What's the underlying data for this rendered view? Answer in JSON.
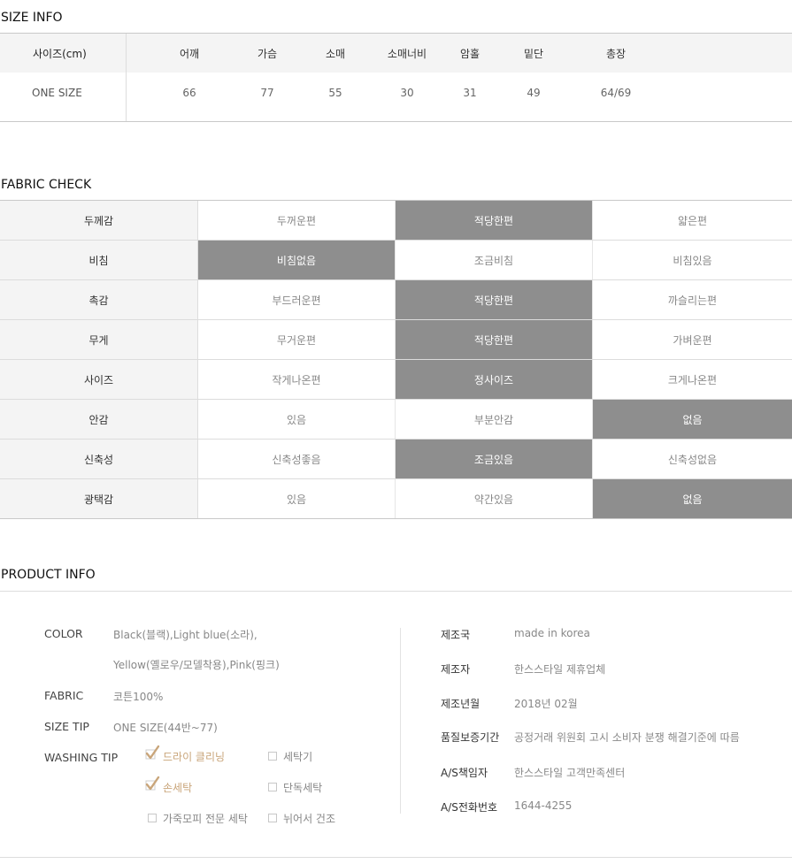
{
  "size_info": {
    "title": "SIZE INFO",
    "header_label": "사이즈(cm)",
    "columns": [
      "어깨",
      "가슴",
      "소매",
      "소매너비",
      "암홀",
      "밑단",
      "총장"
    ],
    "row_label": "ONE SIZE",
    "values": [
      "66",
      "77",
      "55",
      "30",
      "31",
      "49",
      "64/69"
    ]
  },
  "fabric_check": {
    "title": "FABRIC CHECK",
    "rows": [
      {
        "label": "두께감",
        "options": [
          "두꺼운편",
          "적당한편",
          "얇은편"
        ],
        "selected": 1
      },
      {
        "label": "비침",
        "options": [
          "비침없음",
          "조금비침",
          "비침있음"
        ],
        "selected": 0
      },
      {
        "label": "촉감",
        "options": [
          "부드러운편",
          "적당한편",
          "까슬리는편"
        ],
        "selected": 1
      },
      {
        "label": "무게",
        "options": [
          "무거운편",
          "적당한편",
          "가벼운편"
        ],
        "selected": 1
      },
      {
        "label": "사이즈",
        "options": [
          "작게나온편",
          "정사이즈",
          "크게나온편"
        ],
        "selected": 1
      },
      {
        "label": "안감",
        "options": [
          "있음",
          "부분안감",
          "없음"
        ],
        "selected": 2
      },
      {
        "label": "신축성",
        "options": [
          "신축성좋음",
          "조금있음",
          "신축성없음"
        ],
        "selected": 1
      },
      {
        "label": "광택감",
        "options": [
          "있음",
          "약간있음",
          "없음"
        ],
        "selected": 2
      }
    ]
  },
  "product_info": {
    "title": "PRODUCT INFO",
    "color_label": "COLOR",
    "color_line1": "Black(블랙),Light blue(소라),",
    "color_line2": "Yellow(옐로우/모델착용),Pink(핑크)",
    "fabric_label": "FABRIC",
    "fabric_value": "코튼100%",
    "size_tip_label": "SIZE TIP",
    "size_tip_value": "ONE SIZE(44반~77)",
    "washing_label": "WASHING TIP",
    "washing": {
      "dry_cleaning": "드라이 클리닝",
      "hand_wash": "손세탁",
      "leather_pro": "가죽모피 전문 세탁",
      "washer": "세탁기",
      "separate_wash": "단독세탁",
      "lay_flat_dry": "뉘어서 건조"
    },
    "washing_checked": [
      "dry_cleaning",
      "hand_wash"
    ],
    "accent_color": "#c9a57a",
    "right": [
      {
        "label": "제조국",
        "value": "made in korea"
      },
      {
        "label": "제조자",
        "value": "한스스타일 제휴업체"
      },
      {
        "label": "제조년월",
        "value": "2018년 02월"
      },
      {
        "label": "품질보증기간",
        "value": "공정거래 위원회 고시 소비자 분쟁 해결기준에 따름"
      },
      {
        "label": "A/S책임자",
        "value": "한스스타일 고객만족센터"
      },
      {
        "label": "A/S전화번호",
        "value": "1644-4255"
      }
    ]
  }
}
